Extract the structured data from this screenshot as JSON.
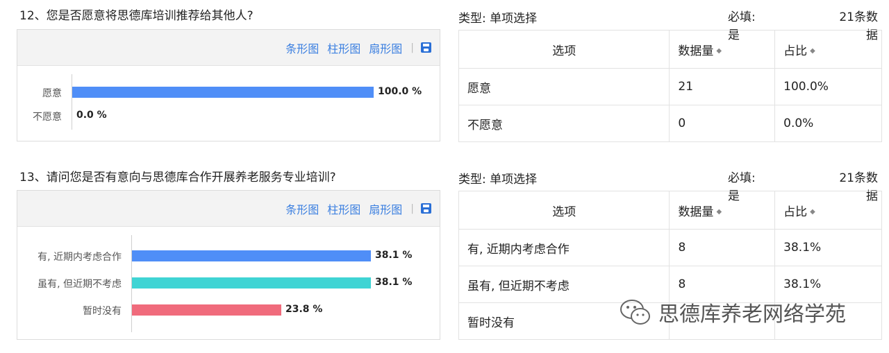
{
  "q12": {
    "title": "12、您是否愿意将思德库培训推荐给其他人?",
    "toolbar": {
      "bar": "条形图",
      "column": "柱形图",
      "pie": "扇形图"
    },
    "meta": {
      "type": "类型:  单项选择",
      "required": "必填:  是",
      "count": "21条数据"
    },
    "table": {
      "headers": [
        "选项",
        "数据量",
        "占比"
      ],
      "rows": [
        [
          "愿意",
          "21",
          "100.0%"
        ],
        [
          "不愿意",
          "0",
          "0.0%"
        ]
      ]
    }
  },
  "q13": {
    "title": "13、请问您是否有意向与思德库合作开展养老服务专业培训?",
    "toolbar": {
      "bar": "条形图",
      "column": "柱形图",
      "pie": "扇形图"
    },
    "meta": {
      "type": "类型:  单项选择",
      "required": "必填:  是",
      "count": "21条数据"
    },
    "table": {
      "headers": [
        "选项",
        "数据量",
        "占比"
      ],
      "rows": [
        [
          "有, 近期内考虑合作",
          "8",
          "38.1%"
        ],
        [
          "虽有, 但近期不考虑",
          "8",
          "38.1%"
        ],
        [
          "暂时没有",
          "",
          ""
        ]
      ]
    }
  },
  "chart_data": [
    {
      "type": "bar",
      "categories": [
        "愿意",
        "不愿意"
      ],
      "values": [
        100.0,
        0.0
      ],
      "value_labels": [
        "100.0 %",
        "0.0 %"
      ],
      "colors": [
        "#4f8ef7",
        "#4f8ef7"
      ],
      "xlim": [
        0,
        100
      ]
    },
    {
      "type": "bar",
      "categories": [
        "有, 近期内考虑合作",
        "虽有, 但近期不考虑",
        "暂时没有"
      ],
      "values": [
        38.1,
        38.1,
        23.8
      ],
      "value_labels": [
        "38.1 %",
        "38.1 %",
        "23.8 %"
      ],
      "colors": [
        "#4f8ef7",
        "#3fd4d4",
        "#f06b7c"
      ],
      "xlim": [
        0,
        38.1
      ]
    }
  ],
  "watermark": {
    "text": "思德库养老网络学苑",
    "icon": "wechat-icon"
  }
}
